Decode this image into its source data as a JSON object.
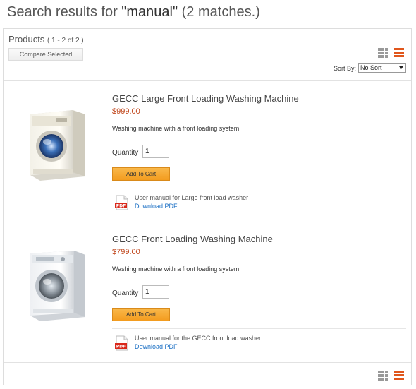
{
  "header": {
    "prefix": "Search results for ",
    "query": "\"manual\"",
    "suffix": " (2 matches.)"
  },
  "toolbar": {
    "heading": "Products",
    "count": "( 1 - 2 of 2 )",
    "compare_label": "Compare Selected",
    "grid_view_icon": "grid-view-icon",
    "list_view_icon": "list-view-icon",
    "active_view": "list",
    "sort_label": "Sort By:",
    "sort_value": "No Sort"
  },
  "products": [
    {
      "name": "GECC Large Front Loading Washing Machine",
      "price": "$999.00",
      "description": "Washing machine with a front loading system.",
      "quantity_label": "Quantity",
      "quantity": "1",
      "add_label": "Add To Cart",
      "doc_description": "User manual for Large front load washer",
      "doc_link": "Download PDF",
      "doc_icon": "pdf-icon"
    },
    {
      "name": "GECC Front Loading Washing Machine",
      "price": "$799.00",
      "description": "Washing machine with a front loading system.",
      "quantity_label": "Quantity",
      "quantity": "1",
      "add_label": "Add To Cart",
      "doc_description": "User manual for the GECC front load washer",
      "doc_link": "Download PDF",
      "doc_icon": "pdf-icon"
    }
  ],
  "pdf_badge": "PDF",
  "colors": {
    "accent": "#e0561c",
    "price": "#c0451a",
    "link": "#1a6fc4",
    "button": "#f39c1f"
  }
}
